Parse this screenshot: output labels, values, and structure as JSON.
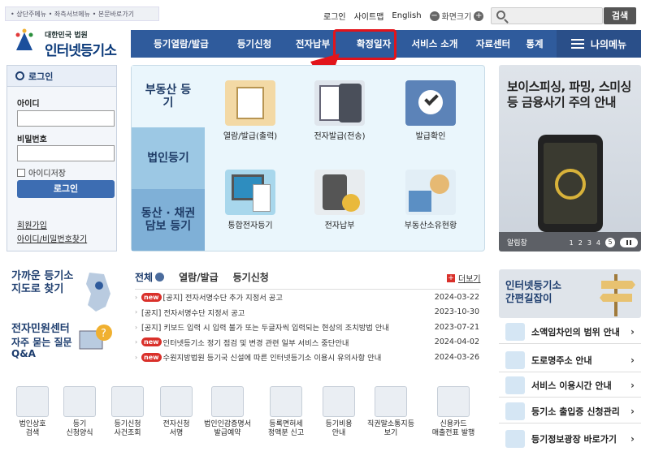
{
  "topbar": {
    "text": "• 상단주메뉴 • 좌측서브메뉴 • 본문바로가기"
  },
  "toplinks": {
    "login": "로그인",
    "sitemap": "사이트맵",
    "english": "English",
    "zoom": "화면크기",
    "minus": "−",
    "plus": "+"
  },
  "search": {
    "button": "검색",
    "placeholder": ""
  },
  "logo": {
    "sub": "대한민국 법원",
    "main": "인터넷등기소"
  },
  "gnb": [
    "등기열람/발급",
    "등기신청",
    "전자납부",
    "확정일자",
    "서비스 소개",
    "자료센터",
    "통계"
  ],
  "my_menu": "나의메뉴",
  "login": {
    "title": "로그인",
    "id_label": "아이디",
    "pw_label": "비밀번호",
    "save_id": "아이디저장",
    "button": "로그인",
    "join": "회원가입",
    "find": "아이디/비밀번호찾기"
  },
  "panel": {
    "cat_real": "부동산 등기",
    "cat_corp": "법인등기",
    "cat_movable": "동산 · 채권 담보 등기",
    "tiles": [
      "열람/발급(출력)",
      "전자발급(전송)",
      "발급확인",
      "통합전자등기",
      "전자납부",
      "부동산소유현황"
    ]
  },
  "banner": {
    "line1": "보이스피싱, 파밍, 스미싱",
    "line2": "등 금융사기 주의 안내",
    "label": "알림창",
    "pages": [
      "1",
      "2",
      "3",
      "4",
      "5"
    ],
    "current": "5"
  },
  "lower_left": {
    "map_title1": "가까운 등기소",
    "map_title2": "지도로 찾기",
    "center_title": "전자민원센터",
    "faq1": "자주 묻는 질문",
    "faq2": "Q&A"
  },
  "notice_tabs": [
    "전체",
    "열람/발급",
    "등기신청"
  ],
  "more": "더보기",
  "new_badge": "new",
  "notices": [
    {
      "new": true,
      "text": "[공지] 전자서명수단 추가 지정서 공고",
      "date": "2024-03-22"
    },
    {
      "new": false,
      "text": "[공지] 전자서명수단 지정서 공고",
      "date": "2023-10-30"
    },
    {
      "new": false,
      "text": "[공지] 키보드 입력 시 입력 불가 또는 두글자씩 입력되는 현상의 조치방법 안내",
      "date": "2023-07-21"
    },
    {
      "new": true,
      "text": "인터넷등기소 정기 점검 및 변경 관련 일부 서비스 중단안내",
      "date": "2024-04-02"
    },
    {
      "new": true,
      "text": "수원지방법원 등기국 신설에 따른 인터넷등기소 이용시 유의사항 안내",
      "date": "2024-03-26"
    }
  ],
  "quick_right": {
    "banner1": "인터넷등기소",
    "banner2": "간편길잡이",
    "links": [
      "소액임차인의 범위 안내",
      "도로명주소 안내",
      "서비스 이용시간 안내",
      "등기소 출입증 신청관리",
      "등기정보광장 바로가기"
    ]
  },
  "bottom_icons": [
    {
      "l1": "법인상호",
      "l2": "검색"
    },
    {
      "l1": "등기",
      "l2": "신청양식"
    },
    {
      "l1": "등기신청",
      "l2": "사건조회"
    },
    {
      "l1": "전자신청",
      "l2": "서명"
    },
    {
      "l1": "법인인감증명서",
      "l2": "발급예약"
    },
    {
      "l1": "등록면허세",
      "l2": "정액분 신고"
    },
    {
      "l1": "등기비용",
      "l2": "안내"
    },
    {
      "l1": "직권말소통지등",
      "l2": "보기"
    },
    {
      "l1": "신용카드",
      "l2": "매출전표 발행"
    }
  ],
  "colors": {
    "navy": "#2f5b9c",
    "highlight": "#e2141b",
    "new": "#d9302a"
  }
}
